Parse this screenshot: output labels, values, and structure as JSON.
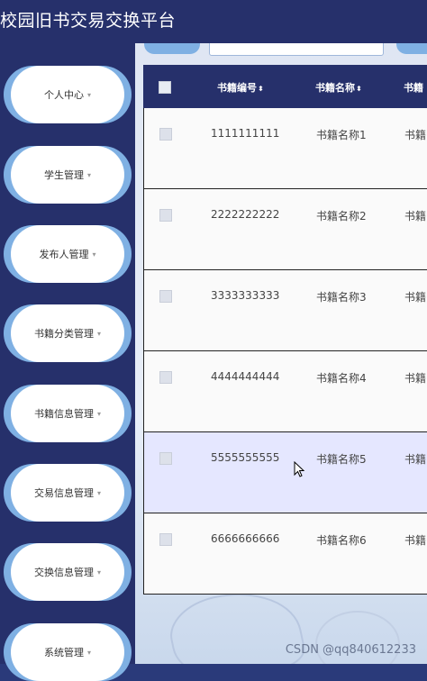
{
  "app": {
    "title": "校园旧书交易交换平台"
  },
  "sidebar": {
    "items": [
      {
        "label": "个人中心"
      },
      {
        "label": "学生管理"
      },
      {
        "label": "发布人管理"
      },
      {
        "label": "书籍分类管理"
      },
      {
        "label": "书籍信息管理"
      },
      {
        "label": "交易信息管理"
      },
      {
        "label": "交换信息管理"
      },
      {
        "label": "系统管理"
      }
    ],
    "chevron": "▾"
  },
  "table": {
    "headers": [
      "书籍编号",
      "书籍名称",
      "书籍"
    ],
    "sort_icon": "⬍",
    "rows": [
      {
        "id": "1111111111",
        "name": "书籍名称1",
        "extra": "书籍"
      },
      {
        "id": "2222222222",
        "name": "书籍名称2",
        "extra": "书籍"
      },
      {
        "id": "3333333333",
        "name": "书籍名称3",
        "extra": "书籍"
      },
      {
        "id": "4444444444",
        "name": "书籍名称4",
        "extra": "书籍"
      },
      {
        "id": "5555555555",
        "name": "书籍名称5",
        "extra": "书籍"
      },
      {
        "id": "6666666666",
        "name": "书籍名称6",
        "extra": "书籍"
      }
    ]
  },
  "watermark": "CSDN @qq840612233",
  "colors": {
    "header": "#26306b",
    "accent": "#7fb0e3",
    "hover_row": "#e5e7ff"
  }
}
